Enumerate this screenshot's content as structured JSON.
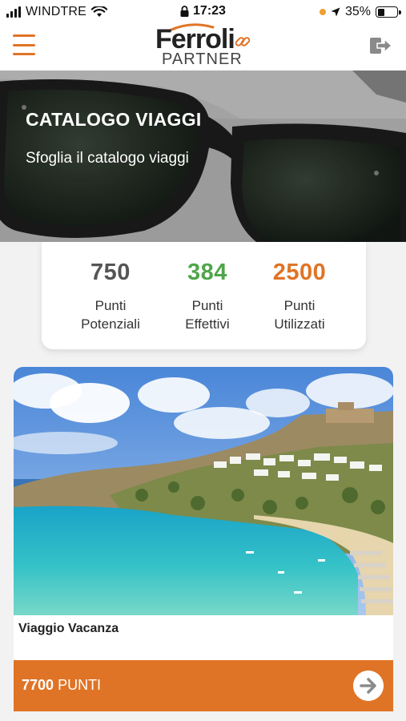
{
  "status_bar": {
    "carrier": "WINDTRE",
    "time": "17:23",
    "battery": "35%"
  },
  "header": {
    "logo_word": "Ferroli",
    "logo_sub": "PARTNER"
  },
  "hero": {
    "title": "CATALOGO VIAGGI",
    "subtitle": "Sfoglia il catalogo viaggi"
  },
  "points": [
    {
      "value": "750",
      "label_line1": "Punti",
      "label_line2": "Potenziali",
      "color": "#555555"
    },
    {
      "value": "384",
      "label_line1": "Punti",
      "label_line2": "Effettivi",
      "color": "#4fa64a"
    },
    {
      "value": "2500",
      "label_line1": "Punti",
      "label_line2": "Utilizzati",
      "color": "#e07426"
    }
  ],
  "product": {
    "name": "Viaggio Vacanza",
    "price_value": "7700",
    "price_unit": "PUNTI"
  },
  "colors": {
    "accent": "#e07426",
    "green": "#4fa64a"
  },
  "icons": [
    "menu-icon",
    "logout-icon",
    "arrow-right-icon",
    "wifi-icon",
    "lock-icon",
    "location-icon",
    "battery-icon",
    "signal-icon"
  ]
}
